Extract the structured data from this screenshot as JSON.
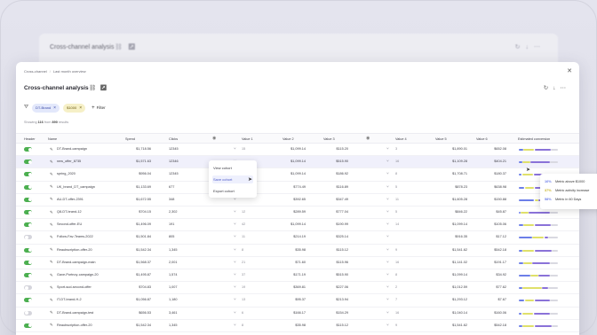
{
  "background_window": {
    "title": "Cross-channel analysis"
  },
  "window": {
    "breadcrumb": [
      "Cross-channel",
      "Last month overview"
    ],
    "title": "Cross-channel analysis"
  },
  "filters": {
    "chips": [
      "DT-Brand",
      "$1000"
    ],
    "add_label": "Filter"
  },
  "showing": {
    "prefix": "Showing",
    "shown": "116",
    "middle": "from",
    "total": "890",
    "suffix": "results"
  },
  "columns": {
    "header": "Header",
    "name": "Name",
    "spend": "Spend",
    "clicks": "Clicks",
    "value1": "Value 1",
    "value2": "Value 2",
    "value3": "Value 3",
    "value4": "Value 4",
    "value5": "Value 5",
    "value6": "Value 6",
    "conversion": "Estimated conversion"
  },
  "rows": [
    {
      "on": true,
      "name": "DT-Brand-campaign",
      "spend": "$1,718.56",
      "clicks": "12345",
      "v1": "15",
      "v2": "$1,099.14",
      "v3": "$115.20",
      "v4": "3",
      "v5": "$1,890.01",
      "v6": "$652.08"
    },
    {
      "on": true,
      "name": "new_offer_8735",
      "spend": "$1,571.63",
      "clicks": "12346",
      "v1": "",
      "v2": "$1,099.14",
      "v3": "$515.90",
      "v4": "16",
      "v5": "$1,109.28",
      "v6": "$404.21"
    },
    {
      "on": true,
      "name": "spring_2020",
      "spend": "$956.04",
      "clicks": "12345",
      "v1": "",
      "v2": "$1,099.14",
      "v3": "$186.92",
      "v4": "8",
      "v5": "$1,708.71",
      "v6": "$180.37"
    },
    {
      "on": true,
      "name": "UK_brand_DT_campaign",
      "spend": "$1,133.69",
      "clicks": "677",
      "v1": "",
      "v2": "$774.49",
      "v3": "$116.89",
      "v4": "5",
      "v5": "$878.23",
      "v6": "$638.98"
    },
    {
      "on": true,
      "name": "AU-DT-offer-2391",
      "spend": "$1,672.55",
      "clicks": "348",
      "v1": "",
      "v2": "$392.65",
      "v3": "$347.49",
      "v4": "11",
      "v5": "$1,605.28",
      "v6": "$150.88"
    },
    {
      "on": true,
      "name": "Q8-DT-brand-12",
      "spend": "$704.15",
      "clicks": "2,302",
      "v1": "12",
      "v2": "$289.59",
      "v3": "$777.04",
      "v4": "5",
      "v5": "$846.22",
      "v6": "$45.87"
    },
    {
      "on": true,
      "name": "Second-offer-EU",
      "spend": "$1,496.09",
      "clicks": "191",
      "v1": "42",
      "v2": "$1,099.14",
      "v3": "$190.99",
      "v4": "14",
      "v5": "$1,099.14",
      "v6": "$105.06"
    },
    {
      "on": false,
      "name": "Follow-Fav-Teams-2022",
      "spend": "$1,501.84",
      "clicks": "805",
      "v1": "11",
      "v2": "$214.19",
      "v3": "$325.14",
      "v4": "",
      "v5": "$916.35",
      "v6": "$17.12"
    },
    {
      "on": true,
      "name": "Reaubscription-offer-20",
      "spend": "$1,542.34",
      "clicks": "1,345",
      "v1": "8",
      "v2": "$35.98",
      "v3": "$115.12",
      "v4": "9",
      "v5": "$1,541.62",
      "v6": "$542.18"
    },
    {
      "on": true,
      "name": "DT-Brand-campaign-main",
      "spend": "$1,568.37",
      "clicks": "2,001",
      "v1": "21",
      "v2": "$71.60",
      "v3": "$115.96",
      "v4": "16",
      "v5": "$1,141.02",
      "v6": "$191.17"
    },
    {
      "on": true,
      "name": "Gave-Portnoy-campaign-20",
      "spend": "$1,495.87",
      "clicks": "1,574",
      "v1": "37",
      "v2": "$171.19",
      "v3": "$515.90",
      "v4": "8",
      "v5": "$1,099.14",
      "v6": "$34.92"
    },
    {
      "on": false,
      "name": "Sport-sud-second-offer",
      "spend": "$704.83",
      "clicks": "1,007",
      "v1": "19",
      "v2": "$369.81",
      "v3": "$227.06",
      "v4": "2",
      "v5": "$1,012.59",
      "v6": "$77.62"
    },
    {
      "on": true,
      "name": "IT-DT-brand-H-2",
      "spend": "$1,056.87",
      "clicks": "1,180",
      "v1": "13",
      "v2": "$95.37",
      "v3": "$213.94",
      "v4": "7",
      "v5": "$1,293.12",
      "v6": "$7.67"
    },
    {
      "on": false,
      "name": "DT-Brand-campaign-test",
      "spend": "$656.53",
      "clicks": "3,461",
      "v1": "6",
      "v2": "$166.17",
      "v3": "$154.29",
      "v4": "16",
      "v5": "$1,040.14",
      "v6": "$160.06"
    },
    {
      "on": true,
      "name": "Reaubscription-offer-20",
      "spend": "$1,542.34",
      "clicks": "1,345",
      "v1": "8",
      "v2": "$35.98",
      "v3": "$115.12",
      "v4": "9",
      "v5": "$1,541.62",
      "v6": "$542.18"
    }
  ],
  "conversion_colors": [
    "#6c7ee8",
    "#dfe06a",
    "#8a72d8",
    "#d9d9e1"
  ],
  "conversion_fractions": [
    [
      0.12,
      0.28,
      0.42,
      0.18
    ],
    [
      0.1,
      0.2,
      0.5,
      0.2
    ],
    [
      0.08,
      0.3,
      0.4,
      0.22
    ],
    [
      0.15,
      0.25,
      0.35,
      0.25
    ],
    [
      0.4,
      0.1,
      0.3,
      0.2
    ],
    [
      0.05,
      0.2,
      0.55,
      0.2
    ],
    [
      0.12,
      0.28,
      0.42,
      0.18
    ],
    [
      0.35,
      0.3,
      0.1,
      0.25
    ],
    [
      0.1,
      0.3,
      0.45,
      0.15
    ],
    [
      0.12,
      0.22,
      0.46,
      0.2
    ],
    [
      0.3,
      0.2,
      0.3,
      0.2
    ],
    [
      0.1,
      0.5,
      0.15,
      0.25
    ],
    [
      0.15,
      0.25,
      0.4,
      0.2
    ],
    [
      0.08,
      0.3,
      0.42,
      0.2
    ],
    [
      0.1,
      0.3,
      0.45,
      0.15
    ]
  ],
  "context_menu": [
    "View cohort",
    "Save cohort",
    "Export cohort"
  ],
  "tooltip": [
    {
      "pct": "16%",
      "text": "Metric above $1000",
      "color": "#6c7ee8"
    },
    {
      "pct": "37%",
      "text": "Metric activity increase",
      "color": "#c9b42a"
    },
    {
      "pct": "58%",
      "text": "Metric in 60 Days",
      "color": "#6c7ee8"
    }
  ]
}
